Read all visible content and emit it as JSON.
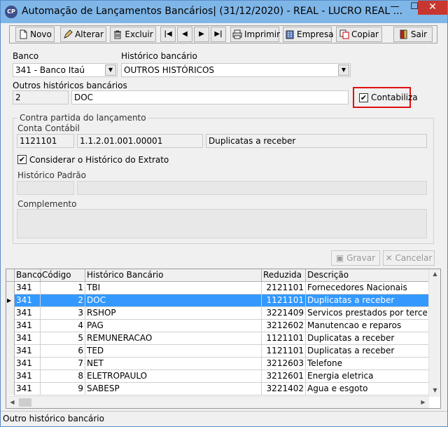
{
  "window": {
    "title": "Automação de Lançamentos Bancários| (31/12/2020) - REAL - LUCRO REAL ...",
    "icon_text": "CP",
    "min_glyph": "—",
    "max_glyph": "☐",
    "close_glyph": "✕"
  },
  "toolbar": {
    "novo": "Novo",
    "alterar": "Alterar",
    "excluir": "Excluir",
    "first": "|◀",
    "prev": "◀",
    "next": "▶",
    "last": "▶|",
    "imprimir": "Imprimir",
    "empresa": "Empresa",
    "copiar": "Copiar",
    "sair": "Sair"
  },
  "form": {
    "banco_label": "Banco",
    "banco_value": "341 - Banco Itaú",
    "historico_label": "Histórico bancário",
    "historico_value": "OUTROS HISTÓRICOS",
    "outros_label": "Outros históricos bancários",
    "outros_code": "2",
    "outros_desc": "DOC",
    "contabiliza_label": "Contabiliza",
    "contabiliza_checked": true,
    "contra_partida_label": "Contra partida do lançamento",
    "conta_contabil_label": "Conta Contábil",
    "conta_code": "1121101",
    "conta_class": "1.1.2.01.001.00001",
    "conta_desc": "Duplicatas a receber",
    "considerar_label": "Considerar o Histórico do Extrato",
    "considerar_checked": true,
    "historico_padrao_label": "Histórico Padrão",
    "historico_padrao_code": "",
    "historico_padrao_desc": "",
    "complemento_label": "Complemento",
    "complemento_value": "",
    "gravar": "Gravar",
    "cancelar": "Cancelar"
  },
  "grid": {
    "columns": [
      "Banco",
      "Código",
      "Histórico Bancário",
      "Reduzida",
      "Descrição"
    ],
    "rows": [
      {
        "banco": "341",
        "codigo": "1",
        "historico": "TBI",
        "reduzida": "2121101",
        "descricao": "Fornecedores Nacionais",
        "selected": false
      },
      {
        "banco": "341",
        "codigo": "2",
        "historico": "DOC",
        "reduzida": "1121101",
        "descricao": "Duplicatas a receber",
        "selected": true
      },
      {
        "banco": "341",
        "codigo": "3",
        "historico": "RSHOP",
        "reduzida": "3221409",
        "descricao": "Servicos prestados por terceiros",
        "selected": false
      },
      {
        "banco": "341",
        "codigo": "4",
        "historico": "PAG",
        "reduzida": "3212602",
        "descricao": "Manutencao e reparos",
        "selected": false
      },
      {
        "banco": "341",
        "codigo": "5",
        "historico": "REMUNERACAO",
        "reduzida": "1121101",
        "descricao": "Duplicatas a receber",
        "selected": false
      },
      {
        "banco": "341",
        "codigo": "6",
        "historico": "TED",
        "reduzida": "1121101",
        "descricao": "Duplicatas a receber",
        "selected": false
      },
      {
        "banco": "341",
        "codigo": "7",
        "historico": "NET",
        "reduzida": "3212603",
        "descricao": "Telefone",
        "selected": false
      },
      {
        "banco": "341",
        "codigo": "8",
        "historico": "ELETROPAULO",
        "reduzida": "3212601",
        "descricao": "Energia eletrica",
        "selected": false
      },
      {
        "banco": "341",
        "codigo": "9",
        "historico": "SABESP",
        "reduzida": "3221402",
        "descricao": "Agua e esgoto",
        "selected": false
      }
    ]
  },
  "status": {
    "text": "Outro histórico bancário"
  },
  "colors": {
    "selection": "#3399ff",
    "highlight_border": "#e01010",
    "titlebar": "#7fb6e8",
    "close_button": "#c7372f"
  }
}
